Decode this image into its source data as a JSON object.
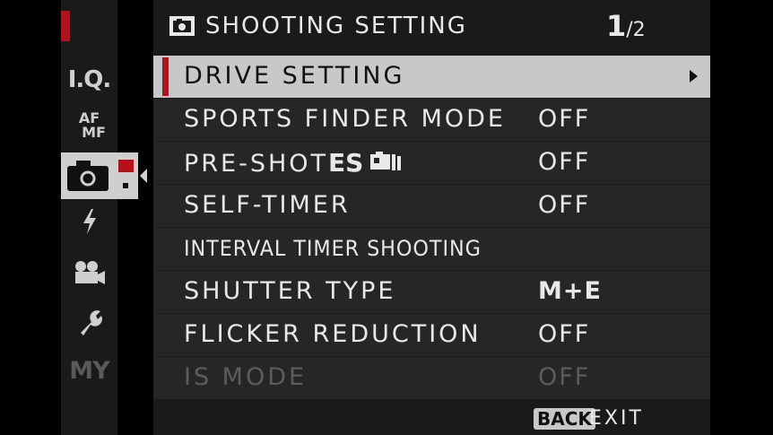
{
  "sidebar": {
    "items": [
      {
        "label": "I.Q.",
        "icon": "image-quality-icon"
      },
      {
        "label_top": "AF",
        "label_bottom": "MF",
        "icon": "af-mf-icon"
      },
      {
        "label": "",
        "icon": "camera-icon",
        "active": true
      },
      {
        "label": "",
        "icon": "flash-icon"
      },
      {
        "label": "",
        "icon": "movie-camera-icon"
      },
      {
        "label": "",
        "icon": "wrench-icon"
      },
      {
        "label": "MY",
        "icon": "my-menu-icon"
      }
    ]
  },
  "header": {
    "title": "SHOOTING SETTING",
    "page_current": "1",
    "page_total": "/2"
  },
  "menu": {
    "rows": [
      {
        "label": "DRIVE SETTING",
        "value": "",
        "selected": true
      },
      {
        "label": "SPORTS FINDER MODE",
        "value": "OFF"
      },
      {
        "label": "PRE-SHOT",
        "label_suffix": "ES",
        "value": "OFF"
      },
      {
        "label": "SELF-TIMER",
        "value": "OFF"
      },
      {
        "label": "INTERVAL TIMER SHOOTING",
        "value": ""
      },
      {
        "label": "SHUTTER TYPE",
        "value": "M+E"
      },
      {
        "label": "FLICKER REDUCTION",
        "value": "OFF"
      },
      {
        "label": "IS MODE",
        "value": "OFF",
        "disabled": true
      }
    ]
  },
  "footer": {
    "back_label": "BACK",
    "exit_label": "EXIT"
  },
  "colors": {
    "accent": "#b3121a",
    "panel": "#1a1a1a",
    "row": "#262626",
    "selected": "#c8c8c8",
    "disabled_text": "#5c5c5c"
  }
}
